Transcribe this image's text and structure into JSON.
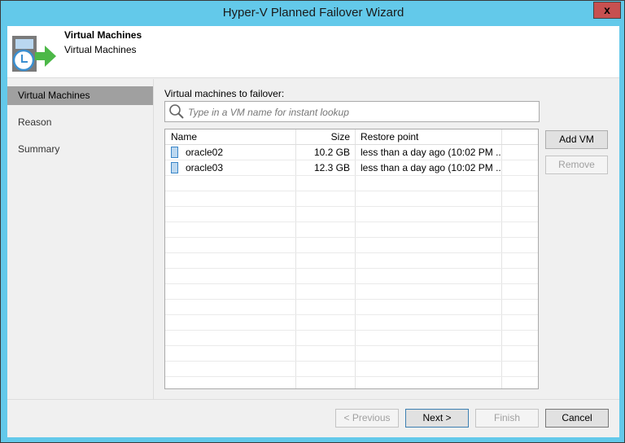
{
  "window": {
    "title": "Hyper-V Planned Failover Wizard",
    "close": "x"
  },
  "header": {
    "title": "Virtual Machines",
    "subtitle": "Virtual Machines"
  },
  "sidebar": {
    "items": [
      {
        "label": "Virtual Machines"
      },
      {
        "label": "Reason"
      },
      {
        "label": "Summary"
      }
    ]
  },
  "main": {
    "label": "Virtual machines to failover:",
    "search_placeholder": "Type in a VM name for instant lookup",
    "columns": [
      "Name",
      "Size",
      "Restore point"
    ],
    "rows": [
      {
        "name": "oracle02",
        "size": "10.2 GB",
        "restore": "less than a day ago (10:02 PM ..."
      },
      {
        "name": "oracle03",
        "size": "12.3 GB",
        "restore": "less than a day ago (10:02 PM ..."
      }
    ],
    "add_vm": "Add VM",
    "remove": "Remove"
  },
  "footer": {
    "previous": "< Previous",
    "next": "Next >",
    "finish": "Finish",
    "cancel": "Cancel"
  }
}
